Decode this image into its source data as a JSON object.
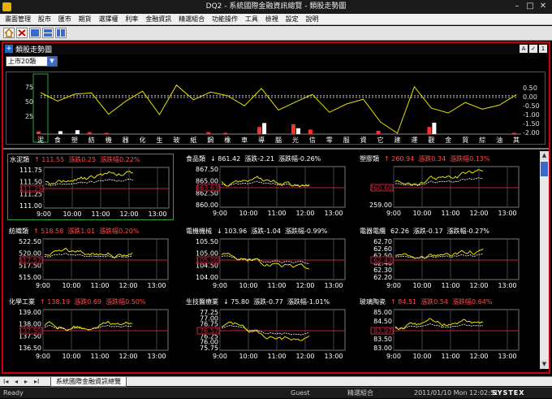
{
  "window": {
    "title": "DQ2 - 系統國際金融資訊總覽 - 類股走勢圖",
    "minimize": "–",
    "maximize": "□",
    "close": "✕"
  },
  "menu": [
    "畫面管理",
    "股市",
    "匯市",
    "期貨",
    "選擇權",
    "利率",
    "金融資訊",
    "精選組合",
    "功能操作",
    "工具",
    "檢視",
    "設定",
    "說明"
  ],
  "panel_title": "類股走勢圖",
  "right_buttons": [
    "A",
    "✓",
    "1"
  ],
  "market_select": "上市20類",
  "sector_chart": {
    "left_ticks": [
      "75",
      "50",
      "25"
    ],
    "right_ticks": [
      "0.50",
      "0.00",
      "-0.50",
      "-1.00",
      "-1.50",
      "-2.00"
    ],
    "categories": [
      "泥",
      "食",
      "塑",
      "紡",
      "機",
      "器",
      "化",
      "生",
      "玻",
      "紙",
      "鋼",
      "橡",
      "車",
      "導",
      "腦",
      "光",
      "信",
      "零",
      "服",
      "資",
      "它",
      "建",
      "運",
      "觀",
      "金",
      "貿",
      "綜",
      "油",
      "其"
    ],
    "change_pct": [
      0.22,
      -0.26,
      0.13,
      0.2,
      -0.99,
      -0.27,
      0.3,
      -1.01,
      0.64,
      -0.18,
      0.25,
      0.05,
      -0.52,
      0.45,
      -0.76,
      -0.31,
      0.12,
      -0.88,
      -0.42,
      -0.15,
      -1.42,
      -2.05,
      0.55,
      -0.65,
      -0.92,
      -0.33,
      -0.71,
      -0.48,
      0.1
    ],
    "bars_up": [
      0,
      9,
      12,
      0,
      0,
      0,
      0,
      0,
      0,
      0,
      0,
      0,
      0,
      34,
      0,
      18,
      0,
      0,
      0,
      0,
      0,
      0,
      0,
      35,
      0,
      0,
      0,
      0,
      0
    ],
    "bars_down": [
      8,
      0,
      0,
      6,
      4,
      0,
      0,
      0,
      0,
      0,
      6,
      4,
      0,
      22,
      0,
      30,
      14,
      0,
      0,
      0,
      10,
      0,
      0,
      22,
      0,
      0,
      0,
      0,
      4
    ]
  },
  "panels": [
    {
      "name": "水泥類",
      "arrow": "↑",
      "price": "111.55",
      "chg_label": "漲跌",
      "chg": "0.25",
      "pct_label": "漲跌幅",
      "pct": "0.22%",
      "dir": "up",
      "ticks": [
        "111.75",
        "111.50",
        "111.25",
        "111.00"
      ],
      "ref_tick": "111.25"
    },
    {
      "name": "食品類",
      "arrow": "↓",
      "price": "861.42",
      "chg_label": "漲跌",
      "chg": "-2.21",
      "pct_label": "漲跌幅",
      "pct": "-0.26%",
      "dir": "dn",
      "ticks": [
        "867.50",
        "865.00",
        "862.50",
        "860.00"
      ],
      "ref_tick": "863.63"
    },
    {
      "name": "塑膠類",
      "arrow": "↑",
      "price": "260.94",
      "chg_label": "漲跌",
      "chg": "0.34",
      "pct_label": "漲跌幅",
      "pct": "0.13%",
      "dir": "up",
      "ticks": [
        "",
        "",
        "259.00"
      ],
      "ref_tick": "260.60"
    },
    {
      "name": "紡織類",
      "arrow": "↑",
      "price": "518.58",
      "chg_label": "漲跌",
      "chg": "1.01",
      "pct_label": "漲跌幅",
      "pct": "0.20%",
      "dir": "up",
      "ticks": [
        "522.50",
        "520.00",
        "517.50",
        "515.00"
      ],
      "ref_tick": "517.57"
    },
    {
      "name": "電機機械",
      "arrow": "↓",
      "price": "103.96",
      "chg_label": "漲跌",
      "chg": "-1.04",
      "pct_label": "漲跌幅",
      "pct": "-0.99%",
      "dir": "dn",
      "ticks": [
        "105.50",
        "105.00",
        "104.50",
        "104.00"
      ],
      "ref_tick": "105.00"
    },
    {
      "name": "電器電纜",
      "arrow": "",
      "price": "62.26",
      "chg_label": "漲跌",
      "chg": "-0.17",
      "pct_label": "漲跌幅",
      "pct": "-0.27%",
      "dir": "neu",
      "ticks": [
        "62.70",
        "62.60",
        "62.50",
        "62.40",
        "62.30",
        "62.20"
      ],
      "ref_tick": "62.43"
    },
    {
      "name": "化學工業",
      "arrow": "↑",
      "price": "138.19",
      "chg_label": "漲跌",
      "chg": "0.69",
      "pct_label": "漲跌幅",
      "pct": "0.50%",
      "dir": "up",
      "ticks": [
        "139.00",
        "138.00",
        "137.50",
        "136.50"
      ],
      "ref_tick": "137.50"
    },
    {
      "name": "生技醫療業",
      "arrow": "↓",
      "price": "75.80",
      "chg_label": "漲跌",
      "chg": "-0.77",
      "pct_label": "漲跌幅",
      "pct": "-1.01%",
      "dir": "dn",
      "ticks": [
        "77.25",
        "77.00",
        "76.75",
        "76.50",
        "76.25",
        "76.00",
        "75.75"
      ],
      "ref_tick": "76.57"
    },
    {
      "name": "玻璃陶瓷",
      "arrow": "↑",
      "price": "84.51",
      "chg_label": "漲跌",
      "chg": "0.54",
      "pct_label": "漲跌幅",
      "pct": "0.64%",
      "dir": "up",
      "ticks": [
        "85.00",
        "84.50",
        "84.00",
        "83.50",
        "83.00"
      ],
      "ref_tick": "83.97"
    }
  ],
  "time_ticks": [
    "9:00",
    "10:00",
    "11:00",
    "12:00",
    "13:00"
  ],
  "colors": {
    "frame": "#d00000",
    "price_line": "#e8e000",
    "avg_line": "#ffffff",
    "ref_line": "#c0263e",
    "up": "#ff4a4a",
    "selected": "#2ea043"
  },
  "tabbar": {
    "nav": [
      "I◂",
      "◂",
      "▸",
      "▸I"
    ],
    "tab": "系統國際金融資訊總覽"
  },
  "status": {
    "ready": "Ready",
    "guest": "Guest",
    "group": "精選組合",
    "datetime": "2011/01/10 Mon 12:02:51",
    "brand": "SYSTEX"
  }
}
